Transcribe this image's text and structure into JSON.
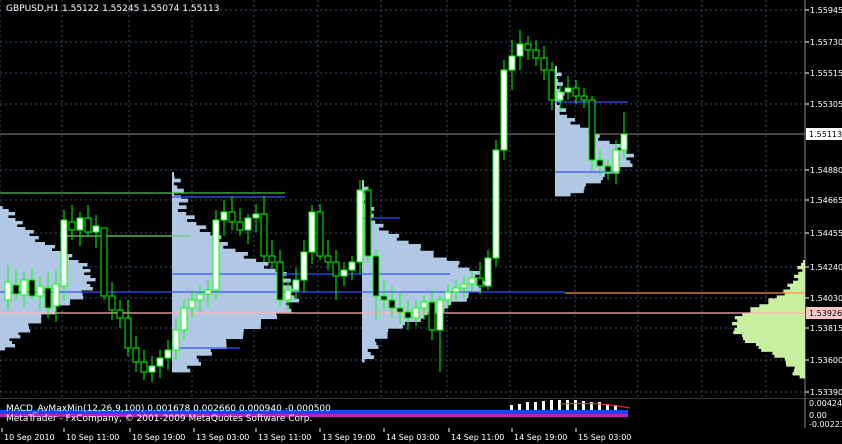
{
  "header": {
    "symbol_line": "GBPUSD,H1  1.55122 1.55245 1.55074 1.55113"
  },
  "indicator": {
    "line1": "MACD_AvMaxMin(12,26,9,100) 0.001678 0.002660 0.000940 -0.000500",
    "line2": "MetaTrader - FxCompany, © 2001-2009 MetaQuotes Software Corp.",
    "labels": [
      "0.00424",
      "0.00",
      "-0.00223"
    ]
  },
  "price_axis": {
    "labels": [
      "1.55945",
      "1.55730",
      "1.55515",
      "1.55305",
      "1.55113",
      "1.54880",
      "1.54665",
      "1.54455",
      "1.54240",
      "1.54030",
      "1.53926",
      "1.53815",
      "1.53600",
      "1.53390"
    ],
    "current": "1.55113",
    "marked": "1.53926"
  },
  "time_axis": {
    "labels": [
      "10 Sep 2010",
      "10 Sep 11:00",
      "10 Sep 19:00",
      "13 Sep 03:00",
      "13 Sep 11:00",
      "13 Sep 19:00",
      "14 Sep 03:00",
      "14 Sep 11:00",
      "14 Sep 19:00",
      "15 Sep 03:00"
    ]
  },
  "colors": {
    "background": "#000000",
    "grid": "#2f4f6f",
    "candle": "#ffffff",
    "bull": "#00ff00",
    "profile": "#b0c8e4",
    "profile_right": "#c8f0a0",
    "blue_line": "#3050ff",
    "orange_line": "#ff9040",
    "pink_line": "#ffb0b0"
  }
}
